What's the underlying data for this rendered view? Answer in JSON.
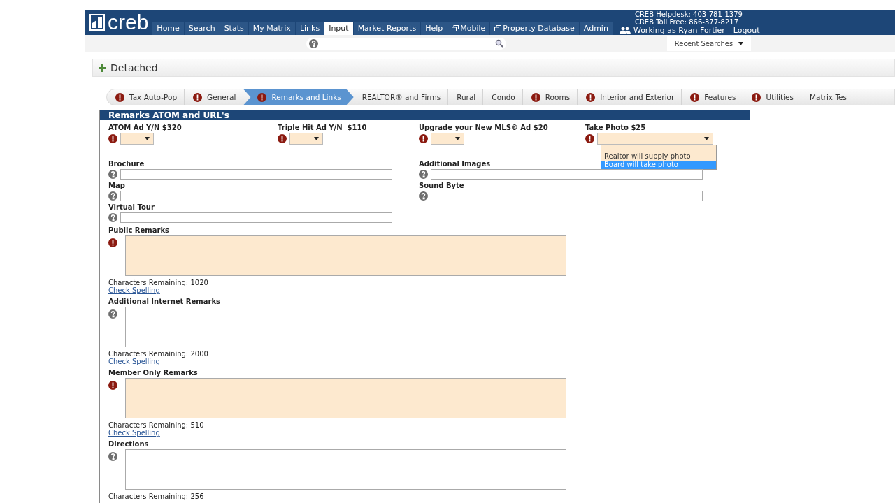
{
  "header": {
    "logo": "creb",
    "nav": [
      {
        "label": "Home",
        "selected": false,
        "external": false
      },
      {
        "label": "Search",
        "selected": false,
        "external": false
      },
      {
        "label": "Stats",
        "selected": false,
        "external": false
      },
      {
        "label": "My Matrix",
        "selected": false,
        "external": false
      },
      {
        "label": "Links",
        "selected": false,
        "external": false
      },
      {
        "label": "Input",
        "selected": true,
        "external": false
      },
      {
        "label": "Market Reports",
        "selected": false,
        "external": false
      },
      {
        "label": "Help",
        "selected": false,
        "external": false
      },
      {
        "label": "Mobile",
        "selected": false,
        "external": true
      },
      {
        "label": "Property Database",
        "selected": false,
        "external": true
      },
      {
        "label": "Admin",
        "selected": false,
        "external": false
      }
    ],
    "helpdesk": [
      "CREB Helpdesk: 403-781-1379",
      "CREB Toll Free: 866-377-8217"
    ],
    "user": "Working as Ryan Fortier",
    "separator": "-",
    "logout": "Logout"
  },
  "subbar": {
    "recent_searches": "Recent Searches"
  },
  "section": {
    "title": "Detached"
  },
  "steps": [
    {
      "label": "Tax Auto-Pop",
      "required": true,
      "selected": false
    },
    {
      "label": "General",
      "required": true,
      "selected": false
    },
    {
      "label": "Remarks and Links",
      "required": true,
      "selected": true
    },
    {
      "label": "REALTOR® and Firms",
      "required": false,
      "selected": false
    },
    {
      "label": "Rural",
      "required": false,
      "selected": false
    },
    {
      "label": "Condo",
      "required": false,
      "selected": false
    },
    {
      "label": "Rooms",
      "required": true,
      "selected": false
    },
    {
      "label": "Interior and Exterior",
      "required": true,
      "selected": false
    },
    {
      "label": "Features",
      "required": true,
      "selected": false
    },
    {
      "label": "Utilities",
      "required": true,
      "selected": false
    },
    {
      "label": "Matrix Tes",
      "required": false,
      "selected": false
    }
  ],
  "form": {
    "title": "Remarks ATOM and URL's",
    "selects": [
      {
        "label": "ATOM Ad Y/N $320",
        "required": true,
        "wide": false,
        "open": false
      },
      {
        "label": "Triple Hit Ad Y/N  $110",
        "required": true,
        "wide": false,
        "open": false
      },
      {
        "label": "Upgrade your New MLS® Ad $20",
        "required": true,
        "wide": false,
        "open": false
      },
      {
        "label": "Take Photo $25",
        "required": true,
        "wide": true,
        "open": true,
        "options": [
          {
            "label": "Realtor will supply photo",
            "selected": false
          },
          {
            "label": "Board will take photo",
            "selected": true
          }
        ]
      }
    ],
    "link_rows": [
      [
        {
          "label": "Brochure"
        },
        {
          "label": "Additional Images"
        }
      ],
      [
        {
          "label": "Map"
        },
        {
          "label": "Sound Byte"
        }
      ],
      [
        {
          "label": "Virtual Tour"
        }
      ]
    ],
    "remarks": [
      {
        "label": "Public Remarks",
        "required": true,
        "remaining": "Characters Remaining: 1020",
        "check": "Check Spelling"
      },
      {
        "label": "Additional Internet Remarks",
        "required": false,
        "remaining": "Characters Remaining: 2000",
        "check": "Check Spelling"
      },
      {
        "label": "Member Only Remarks",
        "required": true,
        "remaining": "Characters Remaining: 510",
        "check": "Check Spelling"
      },
      {
        "label": "Directions",
        "required": false,
        "remaining": "Characters Remaining: 256"
      }
    ]
  }
}
